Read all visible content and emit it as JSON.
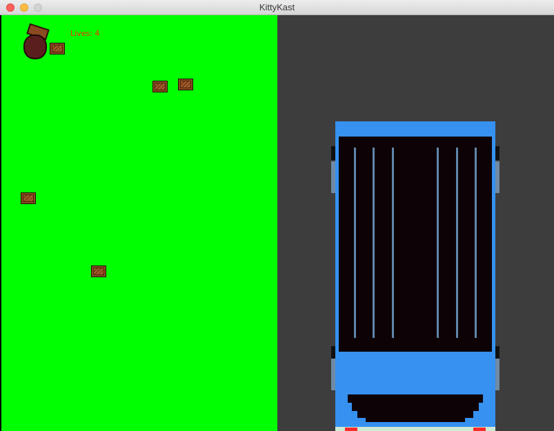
{
  "window": {
    "title": "KittyKast"
  },
  "hud": {
    "lives_text": "Lives: 4"
  },
  "colors": {
    "grass": "#00ff00",
    "road": "#3d3d3d",
    "bus": "#3691f0",
    "lives_text": "#ff2a00"
  },
  "sprites": {
    "player": "cat-in-barrel",
    "obstacle": "wooden-crate",
    "vehicle": "blue-bus"
  }
}
